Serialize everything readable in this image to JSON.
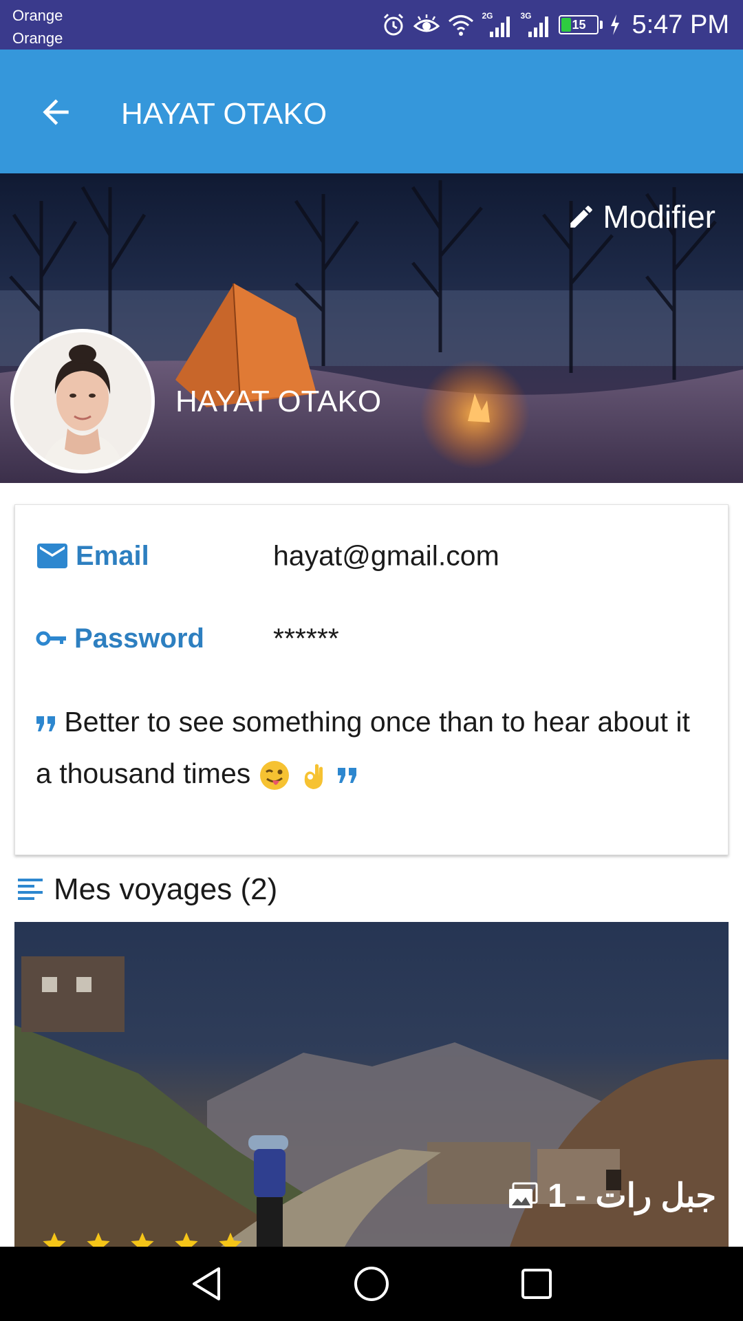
{
  "status_bar": {
    "carriers": [
      "Orange",
      "Orange"
    ],
    "network_1": "2G",
    "network_2": "3G",
    "battery_level": "15",
    "time": "5:47 PM"
  },
  "app_bar": {
    "title": "HAYAT OTAKO",
    "back_icon": "arrow-back-icon"
  },
  "cover": {
    "edit_label": "Modifier",
    "edit_icon": "pencil-icon",
    "name": "HAYAT OTAKO"
  },
  "profile": {
    "email_label": "Email",
    "email_value": "hayat@gmail.com",
    "password_label": "Password",
    "password_value": "******",
    "quote": "Better to see something once than to hear about it a thousand times"
  },
  "trips": {
    "title": "Mes voyages (2)",
    "items": [
      {
        "caption": "جبل رات - 1",
        "rating": 5
      }
    ]
  },
  "colors": {
    "status_bar": "#3a3a8c",
    "app_bar": "#3597db",
    "accent_blue": "#2d7fc0",
    "star": "#f5c518"
  }
}
